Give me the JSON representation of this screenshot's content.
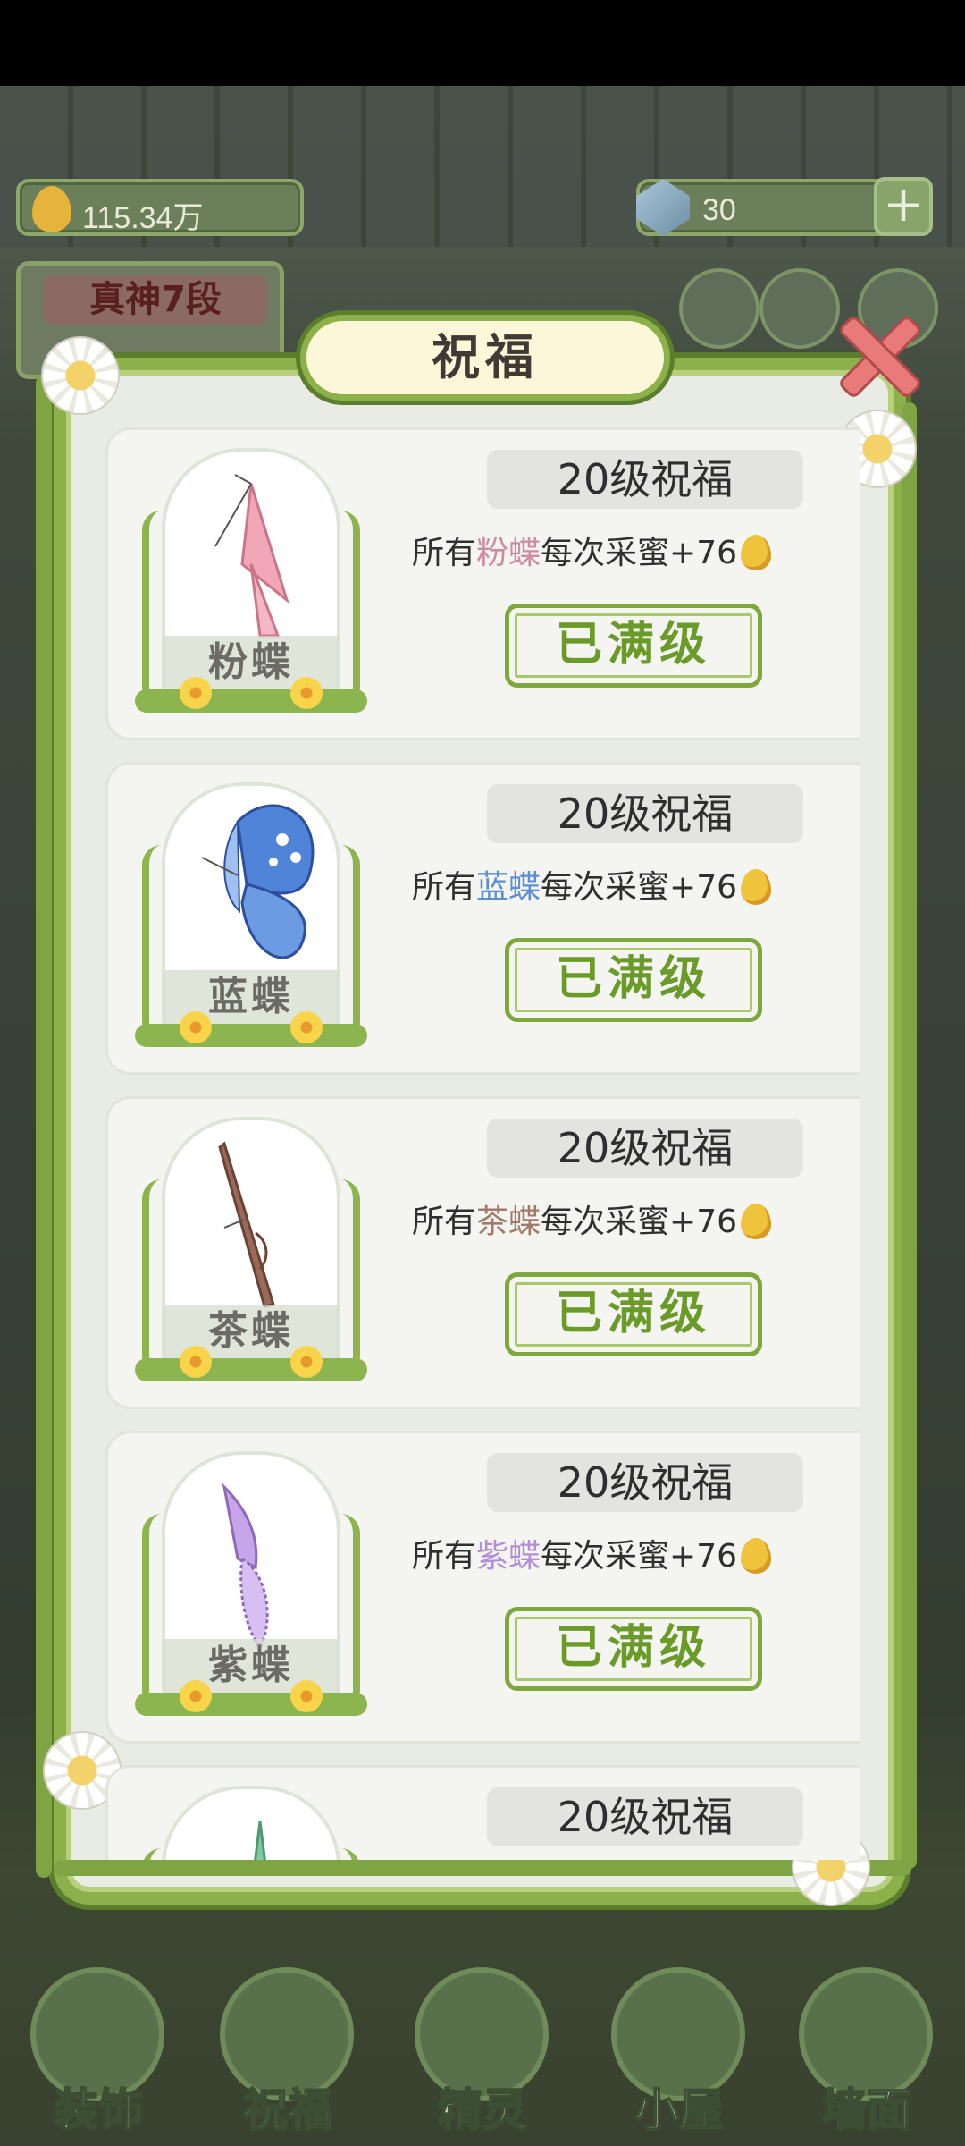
{
  "hud": {
    "honey_amount": "115.34万",
    "gem_amount": "30",
    "plus_symbol": "+",
    "rank_label": "真神7段"
  },
  "dialog": {
    "title": "祝福",
    "cards": [
      {
        "name": "粉蝶",
        "level_text": "20级祝福",
        "desc_prefix": "所有",
        "desc_name": "粉蝶",
        "desc_suffix": "每次采蜜+76",
        "button": "已满级",
        "color": "#f2a7b8"
      },
      {
        "name": "蓝蝶",
        "level_text": "20级祝福",
        "desc_prefix": "所有",
        "desc_name": "蓝蝶",
        "desc_suffix": "每次采蜜+76",
        "button": "已满级",
        "color": "#4f84d8"
      },
      {
        "name": "茶蝶",
        "level_text": "20级祝福",
        "desc_prefix": "所有",
        "desc_name": "茶蝶",
        "desc_suffix": "每次采蜜+76",
        "button": "已满级",
        "color": "#9b6b5a"
      },
      {
        "name": "紫蝶",
        "level_text": "20级祝福",
        "desc_prefix": "所有",
        "desc_name": "紫蝶",
        "desc_suffix": "每次采蜜+76",
        "button": "已满级",
        "color": "#c7a5ea"
      },
      {
        "level_text": "20级祝福"
      }
    ]
  },
  "nav": {
    "items": [
      "装饰",
      "祝福",
      "精灵",
      "小屋",
      "墙面"
    ]
  },
  "icons": {
    "honey": "honey-drop-icon",
    "gem": "gem-icon",
    "close": "close-icon",
    "plus": "plus-icon"
  }
}
